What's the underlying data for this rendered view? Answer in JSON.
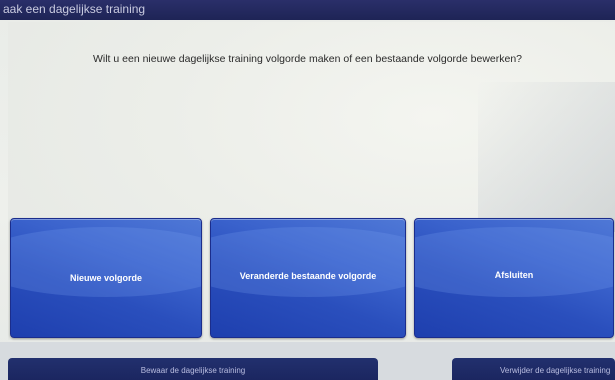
{
  "window": {
    "title": "aak een dagelijkse training"
  },
  "dialog": {
    "question": "Wilt u een nieuwe dagelijkse training volgorde maken of een bestaande volgorde bewerken?",
    "options": [
      {
        "label": "Nieuwe volgorde"
      },
      {
        "label": "Veranderde bestaande volgorde"
      },
      {
        "label": "Afsluiten"
      }
    ]
  },
  "footer": {
    "save_label": "Bewaar de dagelijkse training",
    "delete_label": "Verwijder de dagelijkse training"
  },
  "colors": {
    "titlebar": "#1e2456",
    "button_blue": "#2a4fbd",
    "button_border": "#1b2d8c",
    "footer_button": "#1b2660"
  }
}
